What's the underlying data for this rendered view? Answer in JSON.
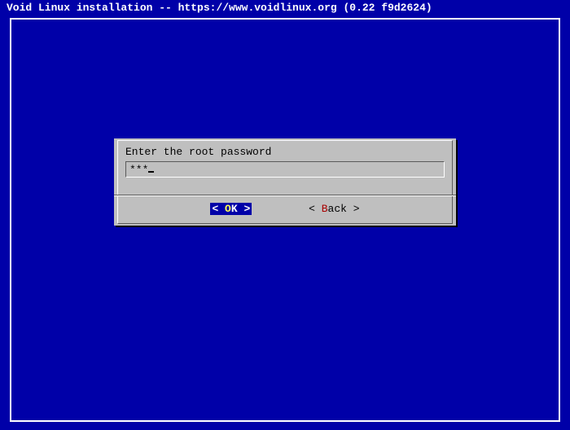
{
  "title": "Void Linux installation -- https://www.voidlinux.org (0.22 f9d2624)",
  "dialog": {
    "prompt": "Enter the root password",
    "input_masked": "***"
  },
  "buttons": {
    "ok_left": "<",
    "ok_hot": " O",
    "ok_rest": "K ",
    "ok_right": ">",
    "back_left": "< ",
    "back_hot": "B",
    "back_rest": "ack ",
    "back_right": ">"
  }
}
